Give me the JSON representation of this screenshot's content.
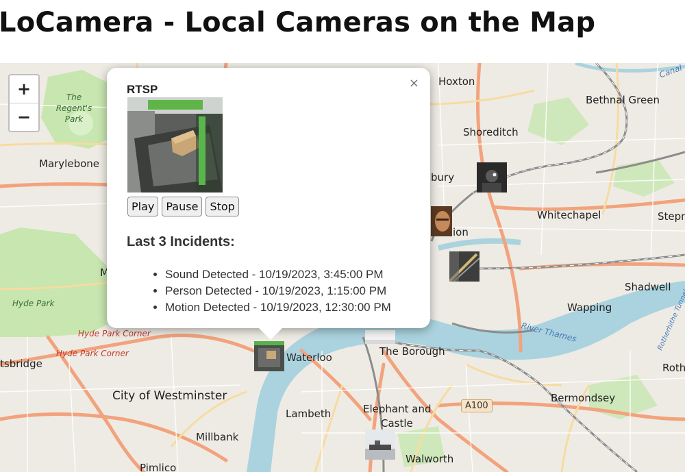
{
  "page": {
    "title": "LoCamera - Local Cameras on the Map"
  },
  "zoom": {
    "in_label": "+",
    "out_label": "−"
  },
  "map_labels": {
    "hoxton": "Hoxton",
    "shoreditch": "Shoreditch",
    "bethnal_green": "Bethnal Green",
    "whitechapel": "Whitechapel",
    "stepney": "Stepn",
    "shadwell": "Shadwell",
    "wapping": "Wapping",
    "marylebone": "Marylebone",
    "regents_park": "The Regent's Park",
    "hyde_park": "Hyde Park",
    "hyde_park_corner_1": "Hyde Park Corner",
    "hyde_park_corner_2": "Hyde Park Corner",
    "knightsbridge": "tsbridge",
    "city_of_westminster": "City of Westminster",
    "lambeth": "Lambeth",
    "millbank": "Millbank",
    "waterloo": "Waterloo",
    "the_borough": "The Borough",
    "elephant_and_castle_1": "Elephant and",
    "elephant_and_castle_2": "Castle",
    "walworth": "Walworth",
    "pimlico": "Pimlico",
    "bermondsey": "Bermondsey",
    "rotherhithe": "Roth",
    "river_thames": "River Thames",
    "rotherhithe_tunnel": "Rotherhithe Tunnel",
    "canal": "Canal",
    "bury_fragment": "bury",
    "ion_fragment": "ion",
    "m_fragment": "M",
    "a100": "A100"
  },
  "popup": {
    "close_label": "×",
    "camera_name": "RTSP",
    "buttons": {
      "play": "Play",
      "pause": "Pause",
      "stop": "Stop"
    },
    "incidents_title": "Last 3 Incidents:",
    "incidents": [
      "Sound Detected - 10/19/2023, 3:45:00 PM",
      "Person Detected - 10/19/2023, 1:15:00 PM",
      "Motion Detected - 10/19/2023, 12:30:00 PM"
    ]
  },
  "colors": {
    "park": "#c8e6b0",
    "water": "#aad3df",
    "major_road": "#f2a37d",
    "secondary_road": "#f7dba0",
    "railway": "#8c8c8c"
  }
}
